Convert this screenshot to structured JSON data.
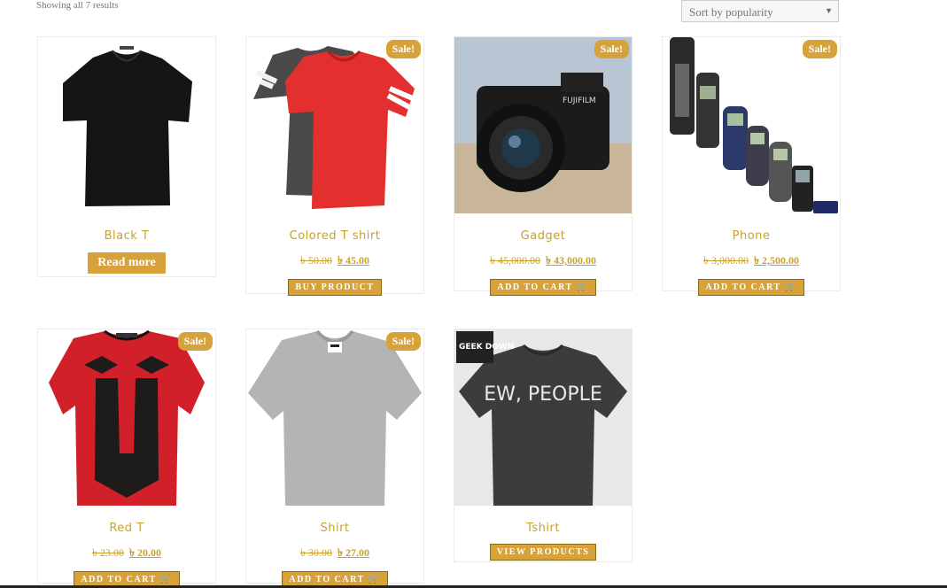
{
  "results_count": "Showing all 7 results",
  "sort": {
    "selected": "Sort by popularity",
    "arrow": "▼"
  },
  "currency": "৳",
  "products": [
    {
      "name": "Black T",
      "sale": "",
      "old_price": "",
      "new_price": "",
      "button": "Read more"
    },
    {
      "name": "Colored T shirt",
      "sale": "Sale!",
      "old_price": "৳ 50.00",
      "new_price": "৳ 45.00",
      "button": "BUY PRODUCT"
    },
    {
      "name": "Gadget",
      "sale": "Sale!",
      "old_price": "৳ 45,000.00",
      "new_price": "৳ 43,000.00",
      "button": "ADD TO CART"
    },
    {
      "name": "Phone",
      "sale": "Sale!",
      "old_price": "৳ 3,000.00",
      "new_price": "৳ 2,500.00",
      "button": "ADD TO CART"
    },
    {
      "name": "Red T",
      "sale": "Sale!",
      "old_price": "৳ 23.00",
      "new_price": "৳ 20.00",
      "button": "ADD TO CART"
    },
    {
      "name": "Shirt",
      "sale": "Sale!",
      "old_price": "৳ 30.00",
      "new_price": "৳ 27.00",
      "button": "ADD TO CART"
    },
    {
      "name": "Tshirt",
      "sale": "",
      "old_price": "",
      "new_price": "",
      "button": "VIEW PRODUCTS"
    }
  ],
  "image_text": {
    "geek_logo": "GEEK DOWN",
    "shirt_print": "EW, PEOPLE",
    "camera_brand": "FUJIFILM"
  },
  "colors": {
    "accent": "#d8a23a",
    "title": "#c9a227"
  }
}
